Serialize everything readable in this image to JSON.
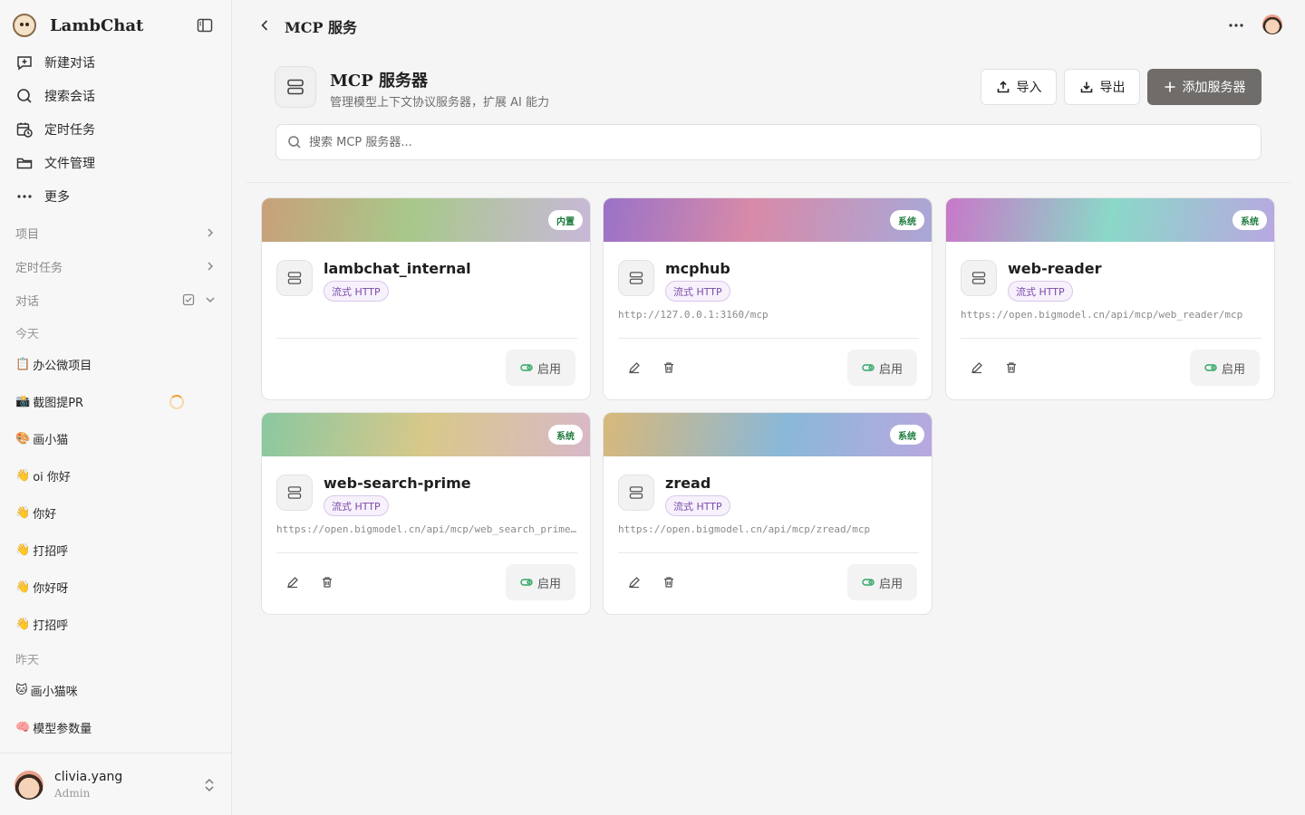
{
  "brand": {
    "name": "LambChat"
  },
  "nav": [
    {
      "label": "新建对话",
      "icon": "new-chat-icon"
    },
    {
      "label": "搜索会话",
      "icon": "search-icon"
    },
    {
      "label": "定时任务",
      "icon": "calendar-clock-icon"
    },
    {
      "label": "文件管理",
      "icon": "folder-icon"
    },
    {
      "label": "更多",
      "icon": "more-icon"
    }
  ],
  "sections": {
    "projects": "项目",
    "scheduled": "定时任务",
    "conversations": "对话"
  },
  "days": {
    "today": "今天",
    "yesterday": "昨天"
  },
  "conversations_today": [
    {
      "emoji": "📋",
      "title": "办公微项目"
    },
    {
      "emoji": "📸",
      "title": "截图提PR"
    },
    {
      "emoji": "🎨",
      "title": "画小猫"
    },
    {
      "emoji": "👋",
      "title": "oi 你好"
    },
    {
      "emoji": "👋",
      "title": " 你好"
    },
    {
      "emoji": "👋",
      "title": " 打招呼"
    },
    {
      "emoji": "👋",
      "title": "你好呀"
    },
    {
      "emoji": "👋",
      "title": " 打招呼"
    }
  ],
  "conversations_yesterday": [
    {
      "emoji": "🐱",
      "title": "画小猫咪"
    },
    {
      "emoji": "🧠",
      "title": "模型参数量"
    }
  ],
  "user": {
    "name": "clivia.yang",
    "role": "Admin"
  },
  "topbar": {
    "title": "MCP 服务"
  },
  "header": {
    "title": "MCP 服务器",
    "subtitle": "管理模型上下文协议服务器，扩展 AI 能力",
    "import_label": "导入",
    "export_label": "导出",
    "add_label": "添加服务器"
  },
  "search": {
    "placeholder": "搜索 MCP 服务器..."
  },
  "enable_label": "启用",
  "servers": [
    {
      "name": "lambchat_internal",
      "badge": "内置",
      "type": "流式 HTTP",
      "url": ""
    },
    {
      "name": "mcphub",
      "badge": "系统",
      "type": "流式 HTTP",
      "url": "http://127.0.0.1:3160/mcp"
    },
    {
      "name": "web-reader",
      "badge": "系统",
      "type": "流式 HTTP",
      "url": "https://open.bigmodel.cn/api/mcp/web_reader/mcp"
    },
    {
      "name": "web-search-prime",
      "badge": "系统",
      "type": "流式 HTTP",
      "url": "https://open.bigmodel.cn/api/mcp/web_search_prime/mcp"
    },
    {
      "name": "zread",
      "badge": "系统",
      "type": "流式 HTTP",
      "url": "https://open.bigmodel.cn/api/mcp/zread/mcp"
    }
  ],
  "colors": {
    "primary_button": "#6f6c69",
    "badge_text": "#1a7a3a",
    "type_tag": "#7a4aa8",
    "enable_icon": "#2fa866"
  }
}
